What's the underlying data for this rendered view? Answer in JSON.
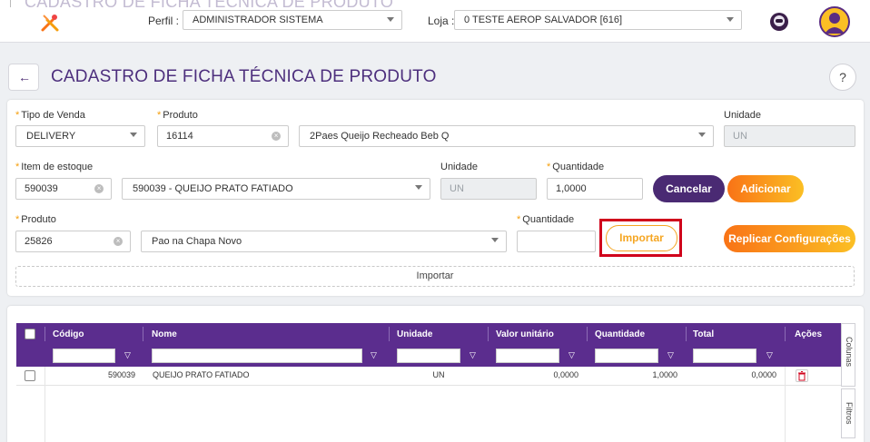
{
  "header": {
    "ghost_title": "CADASTRO DE FICHA TÉCNICA DE PRODUTO",
    "perfil_label": "Perfil :",
    "perfil_value": "ADMINISTRADOR SISTEMA",
    "loja_label": "Loja :",
    "loja_value": "0 TESTE AEROP SALVADOR [616]"
  },
  "page": {
    "back_icon": "←",
    "title": "CADASTRO DE FICHA TÉCNICA DE PRODUTO",
    "help": "?"
  },
  "form": {
    "tipo_venda_label": "Tipo de Venda",
    "tipo_venda_value": "DELIVERY",
    "produto_label": "Produto",
    "produto_code": "16114",
    "produto_name": "2Paes Queijo Recheado Beb Q",
    "unidade_label": "Unidade",
    "unidade_value": "UN",
    "item_label": "Item de estoque",
    "item_code": "590039",
    "item_name": "590039 - QUEIJO PRATO FATIADO",
    "item_unidade_label": "Unidade",
    "item_unidade_value": "UN",
    "quantidade_label": "Quantidade",
    "quantidade_value": "1,0000",
    "cancelar": "Cancelar",
    "adicionar": "Adicionar",
    "produto2_label": "Produto",
    "produto2_code": "25826",
    "produto2_name": "Pao na Chapa Novo",
    "quantidade2_label": "Quantidade",
    "quantidade2_value": "",
    "importar": "Importar",
    "replicar": "Replicar Configurações",
    "importar_area": "Importar"
  },
  "grid": {
    "columns": [
      "Código",
      "Nome",
      "Unidade",
      "Valor unitário",
      "Quantidade",
      "Total",
      "Ações"
    ],
    "rows": [
      {
        "codigo": "590039",
        "nome": "QUEIJO PRATO FATIADO",
        "unidade": "UN",
        "valor": "0,0000",
        "quantidade": "1,0000",
        "total": "0,0000"
      }
    ],
    "side_colunas": "Colunas",
    "side_filtros": "Filtros"
  },
  "colors": {
    "brand_purple": "#5b2d8e",
    "accent_orange": "#f97316",
    "highlight_red": "#d0021b"
  }
}
